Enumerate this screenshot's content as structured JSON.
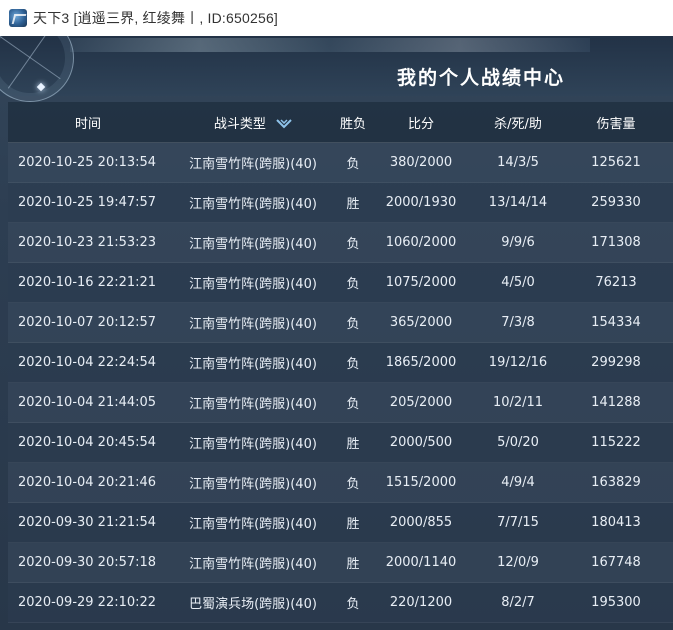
{
  "window": {
    "title": "天下3 [逍遥三界, 红绫舞丨, ID:650256]"
  },
  "page": {
    "title": "我的个人战绩中心"
  },
  "table": {
    "headers": {
      "time": "时间",
      "type": "战斗类型",
      "result": "胜负",
      "score": "比分",
      "kda": "杀/死/助",
      "damage": "伤害量"
    },
    "rows": [
      {
        "time": "2020-10-25 20:13:54",
        "type": "江南雪竹阵(跨服)(40)",
        "result": "负",
        "score": "380/2000",
        "kda": "14/3/5",
        "damage": "125621"
      },
      {
        "time": "2020-10-25 19:47:57",
        "type": "江南雪竹阵(跨服)(40)",
        "result": "胜",
        "score": "2000/1930",
        "kda": "13/14/14",
        "damage": "259330"
      },
      {
        "time": "2020-10-23 21:53:23",
        "type": "江南雪竹阵(跨服)(40)",
        "result": "负",
        "score": "1060/2000",
        "kda": "9/9/6",
        "damage": "171308"
      },
      {
        "time": "2020-10-16 22:21:21",
        "type": "江南雪竹阵(跨服)(40)",
        "result": "负",
        "score": "1075/2000",
        "kda": "4/5/0",
        "damage": "76213"
      },
      {
        "time": "2020-10-07 20:12:57",
        "type": "江南雪竹阵(跨服)(40)",
        "result": "负",
        "score": "365/2000",
        "kda": "7/3/8",
        "damage": "154334"
      },
      {
        "time": "2020-10-04 22:24:54",
        "type": "江南雪竹阵(跨服)(40)",
        "result": "负",
        "score": "1865/2000",
        "kda": "19/12/16",
        "damage": "299298"
      },
      {
        "time": "2020-10-04 21:44:05",
        "type": "江南雪竹阵(跨服)(40)",
        "result": "负",
        "score": "205/2000",
        "kda": "10/2/11",
        "damage": "141288"
      },
      {
        "time": "2020-10-04 20:45:54",
        "type": "江南雪竹阵(跨服)(40)",
        "result": "胜",
        "score": "2000/500",
        "kda": "5/0/20",
        "damage": "115222"
      },
      {
        "time": "2020-10-04 20:21:46",
        "type": "江南雪竹阵(跨服)(40)",
        "result": "负",
        "score": "1515/2000",
        "kda": "4/9/4",
        "damage": "163829"
      },
      {
        "time": "2020-09-30 21:21:54",
        "type": "江南雪竹阵(跨服)(40)",
        "result": "胜",
        "score": "2000/855",
        "kda": "7/7/15",
        "damage": "180413"
      },
      {
        "time": "2020-09-30 20:57:18",
        "type": "江南雪竹阵(跨服)(40)",
        "result": "胜",
        "score": "2000/1140",
        "kda": "12/0/9",
        "damage": "167748"
      },
      {
        "time": "2020-09-29 22:10:22",
        "type": "巴蜀演兵场(跨服)(40)",
        "result": "负",
        "score": "220/1200",
        "kda": "8/2/7",
        "damage": "195300"
      }
    ]
  },
  "icons": {
    "app": "game-logo-icon",
    "sort": "chevron-down-icon",
    "compass": "compass-icon"
  },
  "colors": {
    "panel": "#2d3e52",
    "text": "#e8eef5",
    "title": "#ffffff"
  }
}
